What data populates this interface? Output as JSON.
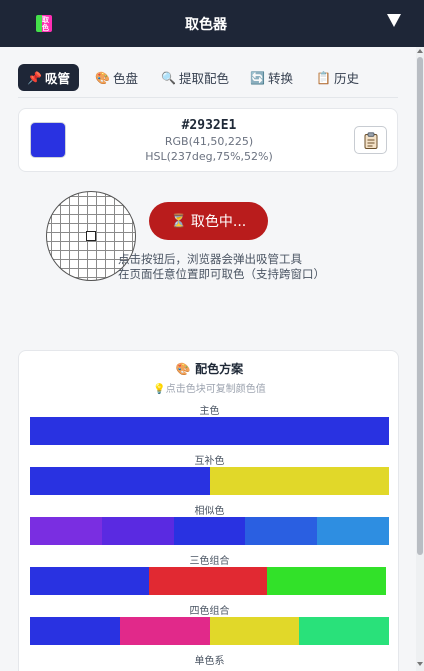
{
  "header": {
    "title": "取色器",
    "logo_text": "取色",
    "logo_icon": "color-picker-logo-icon",
    "dropdown_icon": "triangle-down-icon"
  },
  "tabs": [
    {
      "label": "吸管",
      "icon": "📌",
      "active": true
    },
    {
      "label": "色盘",
      "icon": "🎨",
      "active": false
    },
    {
      "label": "提取配色",
      "icon": "🔍",
      "active": false
    },
    {
      "label": "转换",
      "icon": "🔄",
      "active": false
    },
    {
      "label": "历史",
      "icon": "📋",
      "active": false
    }
  ],
  "current_color": {
    "hex": "#2932E1",
    "rgb": "RGB(41,50,225)",
    "hsl": "HSL(237deg,75%,52%)",
    "swatch_color": "#2932e1",
    "copy_icon": "clipboard-icon"
  },
  "picker": {
    "button_label": "取色中...",
    "button_icon": "hourglass-icon",
    "hint_line1": "点击按钮后，浏览器会弹出吸管工具",
    "hint_line2": "在页面任意位置即可取色（支持跨窗口）"
  },
  "scheme": {
    "title": "配色方案",
    "title_icon": "palette-icon",
    "hint": "点击色块可复制颜色值",
    "hint_icon": "lightbulb-icon",
    "rows": [
      {
        "label": "主色",
        "colors": [
          "#2932e1"
        ]
      },
      {
        "label": "互补色",
        "colors": [
          "#2932e1",
          "#e1d829"
        ]
      },
      {
        "label": "相似色",
        "colors": [
          "#7a2ee1",
          "#5a2ae1",
          "#2932e1",
          "#2a5fe1",
          "#2e8ee1"
        ]
      },
      {
        "label": "三色组合",
        "colors": [
          "#2932e1",
          "#e12932",
          "#32e129"
        ]
      },
      {
        "label": "四色组合",
        "colors": [
          "#2932e1",
          "#e1298a",
          "#e1d829",
          "#29e17a"
        ]
      },
      {
        "label": "单色系",
        "colors": []
      }
    ]
  }
}
